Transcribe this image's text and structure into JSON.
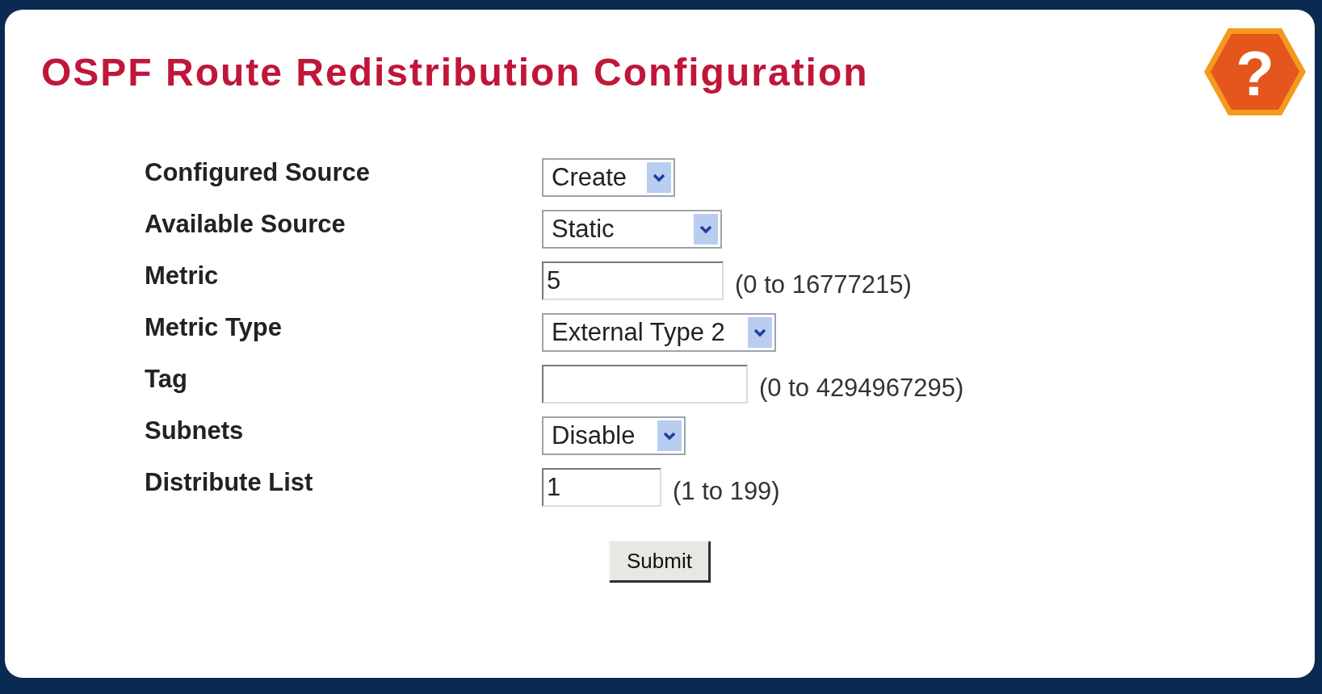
{
  "title": "OSPF Route Redistribution Configuration",
  "help": {
    "label": "?"
  },
  "fields": [
    {
      "label": "Configured Source",
      "kind": "select",
      "value": "Create"
    },
    {
      "label": "Available Source",
      "kind": "select",
      "value": "Static"
    },
    {
      "label": "Metric",
      "kind": "input",
      "value": "5",
      "hint": "(0 to 16777215)"
    },
    {
      "label": "Metric Type",
      "kind": "select",
      "value": "External Type 2"
    },
    {
      "label": "Tag",
      "kind": "input",
      "hint": "(0 to 4294967295)"
    },
    {
      "label": "Subnets",
      "kind": "select",
      "value": "Disable"
    },
    {
      "label": "Distribute List",
      "kind": "input",
      "value": "1",
      "hint": "(1 to 199)"
    }
  ],
  "submit": "Submit"
}
